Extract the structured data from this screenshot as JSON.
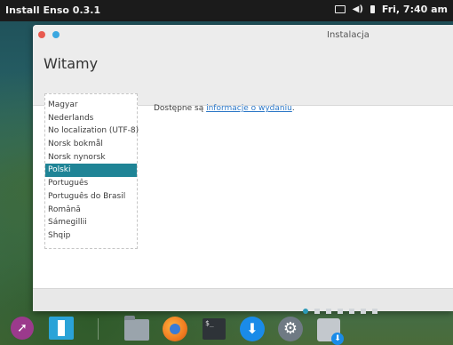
{
  "topbar": {
    "title": "Install Enso 0.3.1",
    "clock": "Fri, 7:40 am",
    "icons": [
      "monitor-icon",
      "sound-icon",
      "battery-icon"
    ]
  },
  "window": {
    "title": "Instalacja",
    "heading": "Witamy",
    "info_text": "Dostępne są ",
    "info_link": "informacje o wydaniu",
    "info_end": "."
  },
  "languages": [
    {
      "label": "Magyar",
      "selected": false
    },
    {
      "label": "Nederlands",
      "selected": false
    },
    {
      "label": "No localization (UTF-8)",
      "selected": false
    },
    {
      "label": "Norsk bokmål",
      "selected": false
    },
    {
      "label": "Norsk nynorsk",
      "selected": false
    },
    {
      "label": "Polski",
      "selected": true
    },
    {
      "label": "Português",
      "selected": false
    },
    {
      "label": "Português do Brasil",
      "selected": false
    },
    {
      "label": "Română",
      "selected": false
    },
    {
      "label": "Sámegillii",
      "selected": false
    },
    {
      "label": "Shqip",
      "selected": false
    }
  ],
  "pager": {
    "total": 7,
    "current": 1
  },
  "dock": [
    "launcher-icon",
    "installer-icon",
    "files-icon",
    "web-browser-icon",
    "terminal-icon",
    "download-icon",
    "settings-icon",
    "drive-install-icon"
  ],
  "colors": {
    "accent": "#1f8496",
    "link": "#2a76c6",
    "panel": "#1b1b1b"
  }
}
